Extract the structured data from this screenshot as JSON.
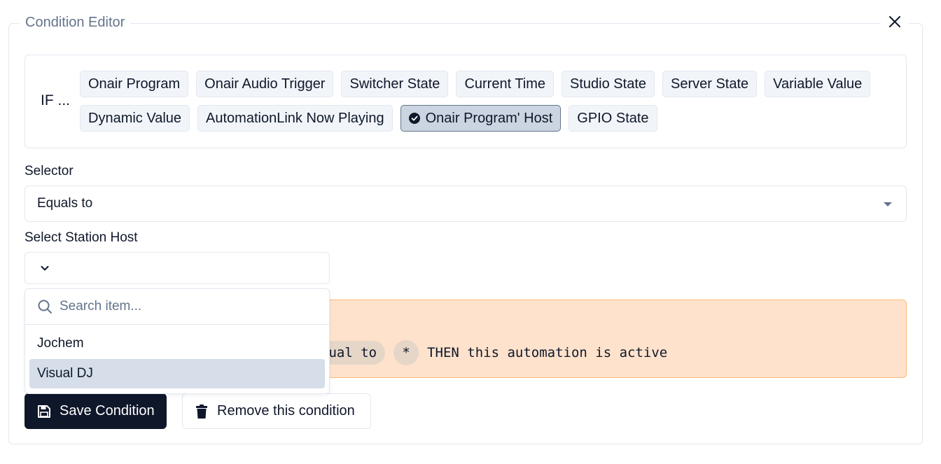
{
  "editor": {
    "legend": "Condition Editor",
    "close_icon": "close-icon"
  },
  "condition_types": {
    "prefix": "IF ...",
    "row1": [
      "Onair Program",
      "Onair Audio Trigger",
      "Switcher State",
      "Current Time",
      "Studio State",
      "Server State",
      "Variable Value"
    ],
    "row2": [
      "Dynamic Value",
      "AutomationLink Now Playing",
      "Onair Program' Host",
      "GPIO State"
    ],
    "selected": "Onair Program' Host",
    "selected_icon": "check-circle-icon"
  },
  "selector": {
    "label": "Selector",
    "value": "Equals to"
  },
  "host": {
    "label": "Select Station Host",
    "value": "",
    "search_placeholder": "Search item...",
    "options": [
      "Jochem",
      "Visual DJ"
    ],
    "highlighted": "Visual DJ"
  },
  "summary": {
    "operator": "qual to",
    "value": "*",
    "result": "THEN this automation is active"
  },
  "actions": {
    "save_label": "Save Condition",
    "remove_label": "Remove this condition"
  },
  "colors": {
    "primary": "#0f172a",
    "summary_bg": "#fee2cc",
    "summary_border": "#fdba74",
    "chip_bg": "#f1f5f9",
    "chip_selected_bg": "#cbd5e1",
    "option_highlight": "#d5dee9"
  }
}
